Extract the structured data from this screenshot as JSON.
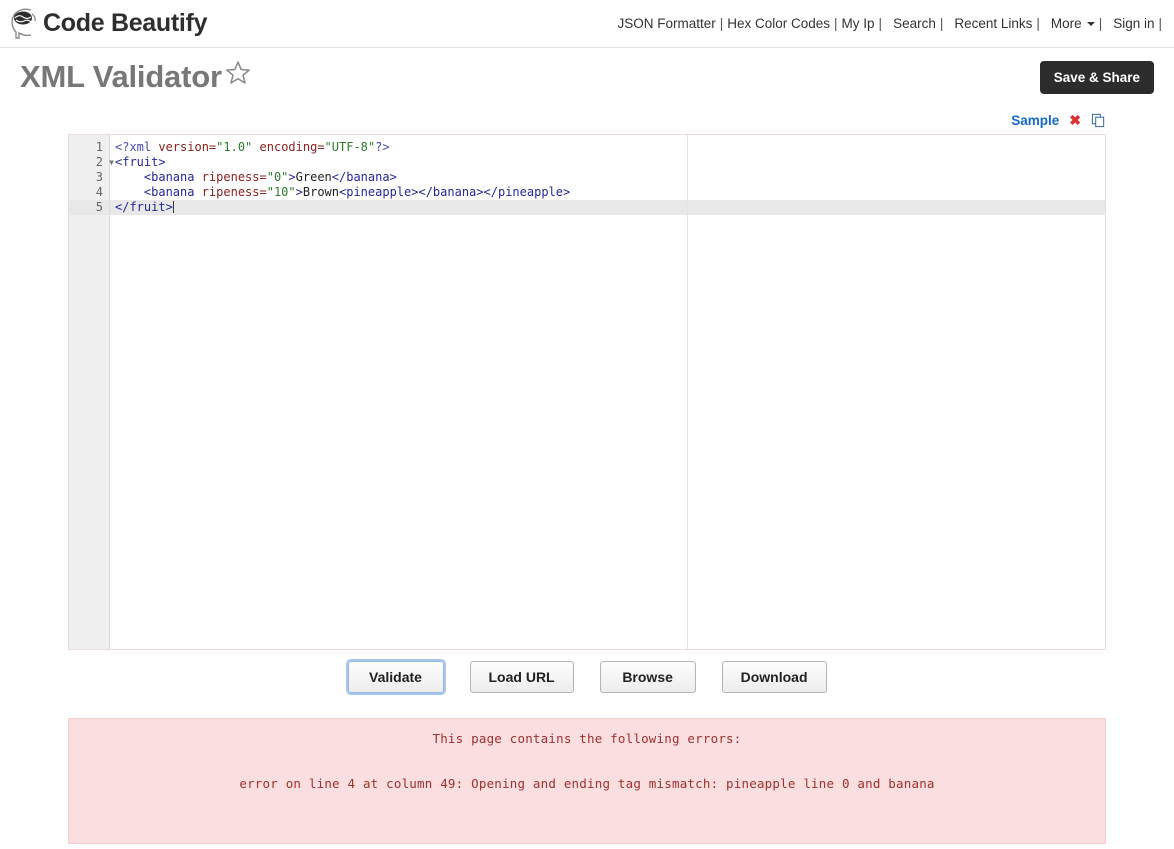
{
  "header": {
    "brand_name": "Code Beautify",
    "brand_logo_icon": "brain-head-logo-icon",
    "nav": [
      {
        "label": "JSON Formatter",
        "sep": "|"
      },
      {
        "label": "Hex Color Codes",
        "sep": "|"
      },
      {
        "label": "My Ip",
        "sep": "|"
      },
      {
        "label": "Search",
        "sep": "|"
      },
      {
        "label": "Recent Links",
        "sep": "|"
      },
      {
        "label": "More",
        "sep": "|",
        "caret": true
      },
      {
        "label": "Sign in",
        "sep": "|"
      }
    ]
  },
  "title_row": {
    "title": "XML Validator",
    "star_icon": "star-outline-icon",
    "save_share_label": "Save & Share"
  },
  "sample_bar": {
    "sample_label": "Sample",
    "clear_icon": "close-x-icon",
    "copy_icon": "copy-clipboard-icon"
  },
  "editor": {
    "line_numbers": [
      "1",
      "2",
      "3",
      "4",
      "5"
    ],
    "fold_line": 2,
    "active_line": 5,
    "lines": [
      {
        "n": "1",
        "tokens": [
          {
            "t": "<?xml ",
            "c": "tk-punct"
          },
          {
            "t": "version=",
            "c": "tk-attr"
          },
          {
            "t": "\"1.0\"",
            "c": "tk-val"
          },
          {
            "t": " ",
            "c": "tk-text"
          },
          {
            "t": "encoding=",
            "c": "tk-attr"
          },
          {
            "t": "\"UTF-8\"",
            "c": "tk-val"
          },
          {
            "t": "?>",
            "c": "tk-punct"
          }
        ]
      },
      {
        "n": "2",
        "tokens": [
          {
            "t": "<fruit>",
            "c": "tk-tag"
          }
        ]
      },
      {
        "n": "3",
        "tokens": [
          {
            "t": "    ",
            "c": "tk-text"
          },
          {
            "t": "<banana ",
            "c": "tk-tag"
          },
          {
            "t": "ripeness=",
            "c": "tk-attr"
          },
          {
            "t": "\"0\"",
            "c": "tk-val"
          },
          {
            "t": ">",
            "c": "tk-tag"
          },
          {
            "t": "Green",
            "c": "tk-text"
          },
          {
            "t": "</banana>",
            "c": "tk-tag"
          }
        ]
      },
      {
        "n": "4",
        "tokens": [
          {
            "t": "    ",
            "c": "tk-text"
          },
          {
            "t": "<banana ",
            "c": "tk-tag"
          },
          {
            "t": "ripeness=",
            "c": "tk-attr"
          },
          {
            "t": "\"10\"",
            "c": "tk-val"
          },
          {
            "t": ">",
            "c": "tk-tag"
          },
          {
            "t": "Brown",
            "c": "tk-text"
          },
          {
            "t": "<pineapple>",
            "c": "tk-tag"
          },
          {
            "t": "</banana>",
            "c": "tk-tag"
          },
          {
            "t": "</pineapple>",
            "c": "tk-tag"
          }
        ]
      },
      {
        "n": "5",
        "tokens": [
          {
            "t": "</fruit>",
            "c": "tk-tag"
          }
        ],
        "caret": true
      }
    ],
    "raw_text": "<?xml version=\"1.0\" encoding=\"UTF-8\"?>\n<fruit>\n    <banana ripeness=\"0\">Green</banana>\n    <banana ripeness=\"10\">Brown<pineapple></banana></pineapple>\n</fruit>"
  },
  "buttons": [
    {
      "label": "Validate",
      "focused": true
    },
    {
      "label": "Load URL",
      "focused": false
    },
    {
      "label": "Browse",
      "focused": false
    },
    {
      "label": "Download",
      "focused": false
    }
  ],
  "error_panel": {
    "title": "This page contains the following errors:",
    "message": "error on line 4 at column 49: Opening and ending tag mismatch: pineapple line 0 and banana"
  },
  "colors": {
    "accent_link": "#1569c7",
    "save_share_bg": "#2c2c2c",
    "error_bg": "#fbdfe0",
    "error_text": "#a03030",
    "title_gray": "#777777",
    "gutter_bg": "#f0f0f0",
    "active_line_bg": "#e8e8e8"
  }
}
